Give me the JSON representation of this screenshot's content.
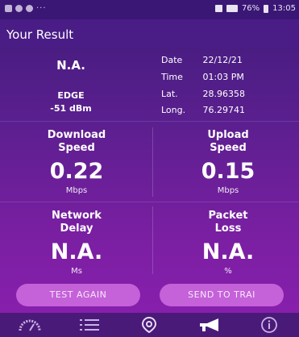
{
  "status_bar": {
    "signal_text": "76%",
    "time": "13:05",
    "more": "···"
  },
  "header": {
    "title": "Your Result"
  },
  "network": {
    "name": "N.A.",
    "type": "EDGE",
    "signal": "-51 dBm"
  },
  "meta": [
    {
      "label": "Date",
      "value": "22/12/21"
    },
    {
      "label": "Time",
      "value": "01:03 PM"
    },
    {
      "label": "Lat.",
      "value": "28.96358"
    },
    {
      "label": "Long.",
      "value": "76.29741"
    }
  ],
  "metrics": {
    "download": {
      "label_line1": "Download",
      "label_line2": "Speed",
      "value": "0.22",
      "unit": "Mbps"
    },
    "upload": {
      "label_line1": "Upload",
      "label_line2": "Speed",
      "value": "0.15",
      "unit": "Mbps"
    },
    "delay": {
      "label_line1": "Network",
      "label_line2": "Delay",
      "value": "N.A.",
      "unit": "Ms"
    },
    "loss": {
      "label_line1": "Packet",
      "label_line2": "Loss",
      "value": "N.A.",
      "unit": "%"
    }
  },
  "buttons": {
    "test_again": "TEST AGAIN",
    "send_to_trai": "SEND TO TRAI"
  },
  "nav_icons": [
    "speedometer-icon",
    "list-icon",
    "location-pin-icon",
    "megaphone-icon",
    "info-icon"
  ]
}
